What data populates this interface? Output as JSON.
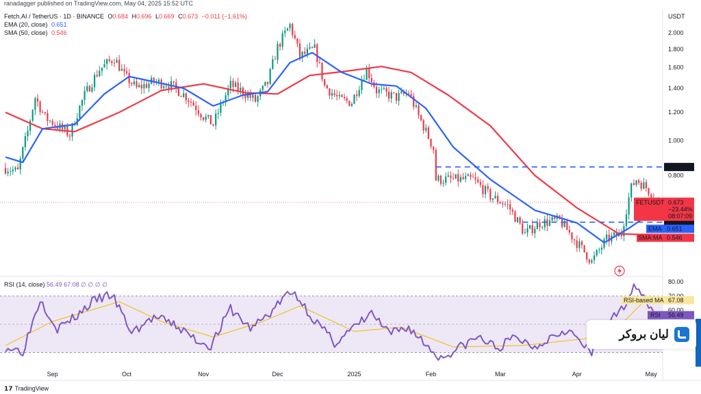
{
  "header": {
    "published": "ranadagger published on TradingView.com, May 04, 2025 15:52 UTC",
    "symbol": "Fetch.AI / TetherUS · 1D · BINANCE",
    "ohlc": [
      {
        "k": "O",
        "v": "0.684"
      },
      {
        "k": "H",
        "v": "0.696"
      },
      {
        "k": "L",
        "v": "0.669"
      },
      {
        "k": "C",
        "v": "0.673"
      }
    ],
    "change": "−0.011 (−1.61%)",
    "ema_label": "EMA (20, close)",
    "ema_value": "0.651",
    "sma_label": "SMA (50, close)",
    "sma_value": "0.546",
    "rsi_label": "RSI (14, close)",
    "rsi_values": "56.49  67.08  ∅  ∅  ∅  ∅"
  },
  "footer": {
    "brand": "TradingView"
  },
  "logo": {
    "text": "لیان بروکر"
  },
  "chart_data": [
    {
      "type": "candlestick",
      "currency": "USDT",
      "y_ticks": [
        0.8,
        1.0,
        1.2,
        1.4,
        1.6,
        1.8,
        2.0
      ],
      "y_tick_labels": [
        "0.800",
        "1.000",
        "1.200",
        "1.400",
        "1.600",
        "1.800",
        "2.000"
      ],
      "x_ticks": [
        {
          "label": "Sep",
          "date": "2024-09-01"
        },
        {
          "label": "Oct",
          "date": "2024-10-01"
        },
        {
          "label": "Nov",
          "date": "2024-11-01"
        },
        {
          "label": "Dec",
          "date": "2024-12-01"
        },
        {
          "label": "2025",
          "date": "2025-01-01"
        },
        {
          "label": "Feb",
          "date": "2025-02-01"
        },
        {
          "label": "Mar",
          "date": "2025-03-01"
        },
        {
          "label": "Apr",
          "date": "2025-04-01"
        },
        {
          "label": "May",
          "date": "2025-05-01"
        }
      ],
      "x_range": [
        "2024-08-13",
        "2025-05-04"
      ],
      "close_key_points": [
        {
          "date": "2024-08-13",
          "close": 0.84
        },
        {
          "date": "2024-08-18",
          "close": 0.82
        },
        {
          "date": "2024-08-22",
          "close": 1.06
        },
        {
          "date": "2024-08-25",
          "close": 1.32
        },
        {
          "date": "2024-08-29",
          "close": 1.16
        },
        {
          "date": "2024-09-03",
          "close": 1.1
        },
        {
          "date": "2024-09-08",
          "close": 1.04
        },
        {
          "date": "2024-09-14",
          "close": 1.34
        },
        {
          "date": "2024-09-20",
          "close": 1.58
        },
        {
          "date": "2024-09-26",
          "close": 1.7
        },
        {
          "date": "2024-09-30",
          "close": 1.52
        },
        {
          "date": "2024-10-05",
          "close": 1.4
        },
        {
          "date": "2024-10-12",
          "close": 1.46
        },
        {
          "date": "2024-10-18",
          "close": 1.44
        },
        {
          "date": "2024-10-25",
          "close": 1.33
        },
        {
          "date": "2024-11-01",
          "close": 1.17
        },
        {
          "date": "2024-11-05",
          "close": 1.11
        },
        {
          "date": "2024-11-12",
          "close": 1.43
        },
        {
          "date": "2024-11-17",
          "close": 1.37
        },
        {
          "date": "2024-11-22",
          "close": 1.29
        },
        {
          "date": "2024-11-27",
          "close": 1.45
        },
        {
          "date": "2024-12-01",
          "close": 1.82
        },
        {
          "date": "2024-12-06",
          "close": 2.1
        },
        {
          "date": "2024-12-10",
          "close": 1.72
        },
        {
          "date": "2024-12-16",
          "close": 1.8
        },
        {
          "date": "2024-12-20",
          "close": 1.42
        },
        {
          "date": "2024-12-26",
          "close": 1.3
        },
        {
          "date": "2024-12-31",
          "close": 1.28
        },
        {
          "date": "2025-01-06",
          "close": 1.58
        },
        {
          "date": "2025-01-10",
          "close": 1.38
        },
        {
          "date": "2025-01-18",
          "close": 1.32
        },
        {
          "date": "2025-01-23",
          "close": 1.36
        },
        {
          "date": "2025-01-27",
          "close": 1.17
        },
        {
          "date": "2025-02-02",
          "close": 0.95
        },
        {
          "date": "2025-02-03",
          "close": 0.78
        },
        {
          "date": "2025-02-08",
          "close": 0.78
        },
        {
          "date": "2025-02-18",
          "close": 0.78
        },
        {
          "date": "2025-02-25",
          "close": 0.7
        },
        {
          "date": "2025-03-04",
          "close": 0.66
        },
        {
          "date": "2025-03-11",
          "close": 0.55
        },
        {
          "date": "2025-03-17",
          "close": 0.59
        },
        {
          "date": "2025-03-25",
          "close": 0.6
        },
        {
          "date": "2025-03-31",
          "close": 0.53
        },
        {
          "date": "2025-04-07",
          "close": 0.46
        },
        {
          "date": "2025-04-13",
          "close": 0.53
        },
        {
          "date": "2025-04-19",
          "close": 0.55
        },
        {
          "date": "2025-04-23",
          "close": 0.74
        },
        {
          "date": "2025-04-25",
          "close": 0.78
        },
        {
          "date": "2025-04-29",
          "close": 0.74
        },
        {
          "date": "2025-05-04",
          "close": 0.673
        }
      ],
      "ema20_key_points": [
        {
          "date": "2024-08-13",
          "v": 0.9
        },
        {
          "date": "2024-08-20",
          "v": 0.87
        },
        {
          "date": "2024-08-28",
          "v": 1.08
        },
        {
          "date": "2024-09-10",
          "v": 1.11
        },
        {
          "date": "2024-09-22",
          "v": 1.35
        },
        {
          "date": "2024-10-02",
          "v": 1.51
        },
        {
          "date": "2024-10-12",
          "v": 1.46
        },
        {
          "date": "2024-10-24",
          "v": 1.4
        },
        {
          "date": "2024-11-05",
          "v": 1.25
        },
        {
          "date": "2024-11-17",
          "v": 1.34
        },
        {
          "date": "2024-11-27",
          "v": 1.37
        },
        {
          "date": "2024-12-06",
          "v": 1.65
        },
        {
          "date": "2024-12-15",
          "v": 1.76
        },
        {
          "date": "2024-12-27",
          "v": 1.55
        },
        {
          "date": "2025-01-08",
          "v": 1.44
        },
        {
          "date": "2025-01-18",
          "v": 1.42
        },
        {
          "date": "2025-01-30",
          "v": 1.23
        },
        {
          "date": "2025-02-10",
          "v": 0.96
        },
        {
          "date": "2025-02-25",
          "v": 0.78
        },
        {
          "date": "2025-03-15",
          "v": 0.64
        },
        {
          "date": "2025-04-01",
          "v": 0.59
        },
        {
          "date": "2025-04-12",
          "v": 0.52
        },
        {
          "date": "2025-04-22",
          "v": 0.57
        },
        {
          "date": "2025-05-04",
          "v": 0.651
        }
      ],
      "sma50_key_points": [
        {
          "date": "2024-08-13",
          "v": 1.2
        },
        {
          "date": "2024-08-28",
          "v": 1.08
        },
        {
          "date": "2024-09-10",
          "v": 1.06
        },
        {
          "date": "2024-09-28",
          "v": 1.2
        },
        {
          "date": "2024-10-15",
          "v": 1.38
        },
        {
          "date": "2024-11-01",
          "v": 1.44
        },
        {
          "date": "2024-11-18",
          "v": 1.36
        },
        {
          "date": "2024-12-01",
          "v": 1.35
        },
        {
          "date": "2024-12-14",
          "v": 1.52
        },
        {
          "date": "2024-12-28",
          "v": 1.56
        },
        {
          "date": "2025-01-12",
          "v": 1.61
        },
        {
          "date": "2025-01-24",
          "v": 1.55
        },
        {
          "date": "2025-02-08",
          "v": 1.34
        },
        {
          "date": "2025-02-25",
          "v": 1.1
        },
        {
          "date": "2025-03-15",
          "v": 0.8
        },
        {
          "date": "2025-04-01",
          "v": 0.65
        },
        {
          "date": "2025-04-18",
          "v": 0.55
        },
        {
          "date": "2025-05-04",
          "v": 0.546
        }
      ],
      "horizontal_levels": [
        {
          "value": 0.845,
          "label": "0.845",
          "style": "dashed",
          "from": "2025-02-03"
        },
        {
          "value": 0.593,
          "label": "0.593",
          "style": "dashed",
          "from": "2025-03-10"
        }
      ],
      "price_labels": [
        {
          "name": "FETUSDT",
          "value": 0.673,
          "text": "0.673",
          "change": "−23.44%",
          "countdown": "08:07:09",
          "color": "#f23645"
        },
        {
          "name": "EMA",
          "value": 0.651,
          "text": "0.651",
          "color": "#2962ff"
        },
        {
          "name": "SMA:MA",
          "value": 0.546,
          "text": "0.546",
          "color": "#f23645"
        }
      ],
      "colors": {
        "up": "#089981",
        "down": "#f23645",
        "ema": "#2962ff",
        "sma": "#f23645",
        "level": "#2962ff"
      }
    },
    {
      "type": "line",
      "name": "RSI (14, close)",
      "y_ticks": [
        60,
        70,
        80
      ],
      "y_tick_labels": [
        "60.00",
        "70.00",
        "80.00"
      ],
      "band": [
        30,
        70
      ],
      "rsi_key_points": [
        {
          "date": "2024-08-13",
          "v": 34
        },
        {
          "date": "2024-08-20",
          "v": 31
        },
        {
          "date": "2024-08-27",
          "v": 68
        },
        {
          "date": "2024-09-03",
          "v": 47
        },
        {
          "date": "2024-09-10",
          "v": 55
        },
        {
          "date": "2024-09-18",
          "v": 67
        },
        {
          "date": "2024-09-25",
          "v": 71
        },
        {
          "date": "2024-10-03",
          "v": 44
        },
        {
          "date": "2024-10-12",
          "v": 55
        },
        {
          "date": "2024-10-20",
          "v": 50
        },
        {
          "date": "2024-10-30",
          "v": 38
        },
        {
          "date": "2024-11-04",
          "v": 35
        },
        {
          "date": "2024-11-12",
          "v": 61
        },
        {
          "date": "2024-11-20",
          "v": 47
        },
        {
          "date": "2024-11-28",
          "v": 58
        },
        {
          "date": "2024-12-04",
          "v": 70
        },
        {
          "date": "2024-12-08",
          "v": 72
        },
        {
          "date": "2024-12-15",
          "v": 55
        },
        {
          "date": "2024-12-24",
          "v": 37
        },
        {
          "date": "2025-01-02",
          "v": 49
        },
        {
          "date": "2025-01-08",
          "v": 58
        },
        {
          "date": "2025-01-15",
          "v": 43
        },
        {
          "date": "2025-01-23",
          "v": 48
        },
        {
          "date": "2025-02-01",
          "v": 32
        },
        {
          "date": "2025-02-05",
          "v": 26
        },
        {
          "date": "2025-02-12",
          "v": 33
        },
        {
          "date": "2025-02-20",
          "v": 41
        },
        {
          "date": "2025-02-28",
          "v": 33
        },
        {
          "date": "2025-03-07",
          "v": 41
        },
        {
          "date": "2025-03-15",
          "v": 34
        },
        {
          "date": "2025-03-22",
          "v": 42
        },
        {
          "date": "2025-03-28",
          "v": 47
        },
        {
          "date": "2025-04-07",
          "v": 29
        },
        {
          "date": "2025-04-12",
          "v": 50
        },
        {
          "date": "2025-04-18",
          "v": 57
        },
        {
          "date": "2025-04-23",
          "v": 74
        },
        {
          "date": "2025-04-26",
          "v": 78
        },
        {
          "date": "2025-04-29",
          "v": 66
        },
        {
          "date": "2025-05-04",
          "v": 56.49
        }
      ],
      "rsi_ma_key_points": [
        {
          "date": "2024-08-13",
          "v": 35
        },
        {
          "date": "2024-09-01",
          "v": 52
        },
        {
          "date": "2024-09-28",
          "v": 66
        },
        {
          "date": "2024-10-15",
          "v": 52
        },
        {
          "date": "2024-11-05",
          "v": 41
        },
        {
          "date": "2024-11-25",
          "v": 52
        },
        {
          "date": "2024-12-10",
          "v": 63
        },
        {
          "date": "2025-01-01",
          "v": 45
        },
        {
          "date": "2025-01-20",
          "v": 48
        },
        {
          "date": "2025-02-10",
          "v": 34
        },
        {
          "date": "2025-03-10",
          "v": 35
        },
        {
          "date": "2025-04-05",
          "v": 40
        },
        {
          "date": "2025-04-20",
          "v": 52
        },
        {
          "date": "2025-04-28",
          "v": 66
        },
        {
          "date": "2025-05-04",
          "v": 67.08
        }
      ],
      "labels": [
        {
          "name": "RSI-based MA",
          "value": 67.08,
          "text": "67.08"
        },
        {
          "name": "RSI",
          "value": 56.49,
          "text": "56.49"
        }
      ],
      "colors": {
        "rsi": "#7e57c2",
        "ma": "#f0c419",
        "band": "#ede7f6"
      }
    }
  ]
}
